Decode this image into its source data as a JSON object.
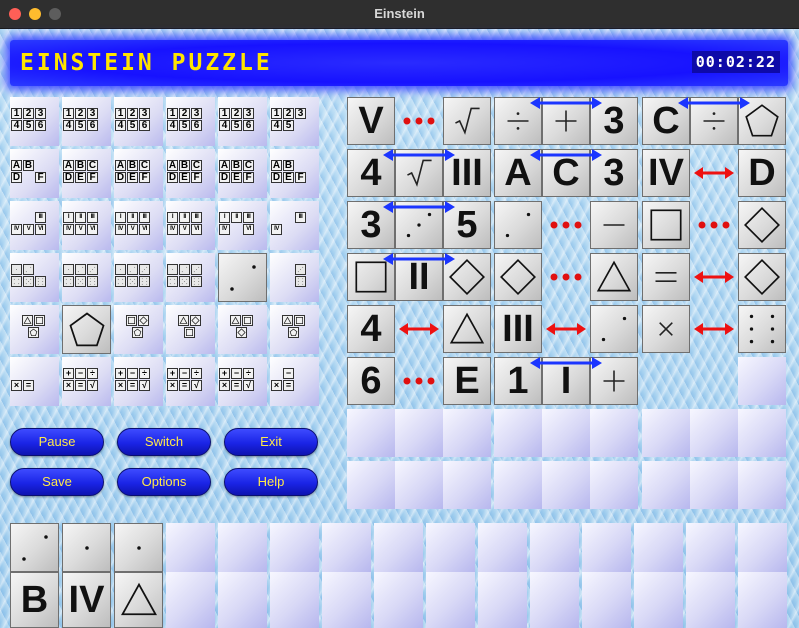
{
  "window": {
    "title": "Einstein"
  },
  "banner": {
    "title": "EINSTEIN PUZZLE",
    "timer": "00:02:22"
  },
  "buttons": [
    "Pause",
    "Switch",
    "Exit",
    "Save",
    "Options",
    "Help"
  ],
  "candidates": {
    "row_numbers": [
      [
        "1",
        "2",
        "3",
        "4",
        "5",
        "6"
      ],
      [
        "1",
        "2",
        "3",
        "4",
        "5",
        "6"
      ],
      [
        "1",
        "2",
        "3",
        "4",
        "5",
        "6"
      ],
      [
        "1",
        "2",
        "3",
        "4",
        "5",
        "6"
      ],
      [
        "1",
        "2",
        "3",
        "4",
        "5",
        "6"
      ],
      [
        "1",
        "2",
        "3",
        "4",
        "5",
        ""
      ]
    ],
    "row_letters": [
      [
        "A",
        "B",
        "",
        "D",
        "",
        "F"
      ],
      [
        "A",
        "B",
        "C",
        "D",
        "E",
        "F"
      ],
      [
        "A",
        "B",
        "C",
        "D",
        "E",
        "F"
      ],
      [
        "A",
        "B",
        "C",
        "D",
        "E",
        "F"
      ],
      [
        "A",
        "B",
        "C",
        "D",
        "E",
        "F"
      ],
      [
        "A",
        "B",
        "",
        "D",
        "E",
        "F"
      ]
    ],
    "row_roman": [
      [
        "",
        "",
        "III",
        "IV",
        "V",
        "VI"
      ],
      [
        "I",
        "II",
        "III",
        "IV",
        "V",
        "VI"
      ],
      [
        "I",
        "II",
        "III",
        "IV",
        "V",
        "VI"
      ],
      [
        "I",
        "II",
        "III",
        "IV",
        "V",
        "VI"
      ],
      [
        "I",
        "II",
        "III",
        "IV",
        "",
        "VI"
      ],
      [
        "",
        "",
        "III",
        "IV",
        "",
        ""
      ]
    ],
    "row_math": [
      [
        "",
        "",
        "",
        "×",
        "=",
        ""
      ],
      [
        "+",
        "−",
        "÷",
        "×",
        "=",
        "√"
      ],
      [
        "+",
        "−",
        "÷",
        "×",
        "=",
        "√"
      ],
      [
        "+",
        "−",
        "÷",
        "×",
        "=",
        "√"
      ],
      [
        "+",
        "−",
        "÷",
        "×",
        "=",
        "√"
      ],
      [
        "",
        "−",
        "",
        "×",
        "=",
        ""
      ]
    ]
  },
  "clues": [
    {
      "a": "V",
      "b": "√",
      "type": "near"
    },
    {
      "a": "÷",
      "b": "+",
      "c": "3",
      "type": "between"
    },
    {
      "a": "C",
      "b": "÷",
      "c": "pentagon",
      "type": "between"
    },
    {
      "a": "4",
      "b": "√",
      "c": "III",
      "type": "between"
    },
    {
      "a": "A",
      "b": "C",
      "c": "3",
      "type": "between"
    },
    {
      "a": "IV",
      "b": "D",
      "type": "adjacent"
    },
    {
      "a": "3",
      "b": "dice-3",
      "c": "5",
      "type": "between"
    },
    {
      "a": "dice-2",
      "b": "−",
      "type": "near"
    },
    {
      "a": "square",
      "b": "diamond",
      "type": "near"
    },
    {
      "a": "square",
      "b": "II",
      "c": "diamond",
      "type": "between"
    },
    {
      "a": "diamond",
      "b": "triangle",
      "type": "near"
    },
    {
      "a": "=",
      "b": "diamond",
      "type": "adjacent"
    },
    {
      "a": "4",
      "b": "triangle",
      "type": "adjacent"
    },
    {
      "a": "III",
      "b": "dice-2",
      "type": "adjacent"
    },
    {
      "a": "×",
      "b": "dice-6",
      "type": "adjacent"
    },
    {
      "a": "6",
      "b": "E",
      "type": "near"
    },
    {
      "a": "1",
      "b": "I",
      "c": "+",
      "type": "between"
    }
  ],
  "bottom_clues": [
    {
      "top": "dice-2",
      "bottom": "B"
    },
    {
      "top": "dice-1",
      "bottom": "IV"
    },
    {
      "top": "dice-1",
      "bottom": "triangle"
    }
  ],
  "colors": {
    "banner": "#1712ff",
    "title_text": "#ffe400",
    "button": "#1a24e6",
    "button_text": "#ffe94a",
    "arrow_blue": "#1b35ff",
    "arrow_red": "#ee1111"
  }
}
